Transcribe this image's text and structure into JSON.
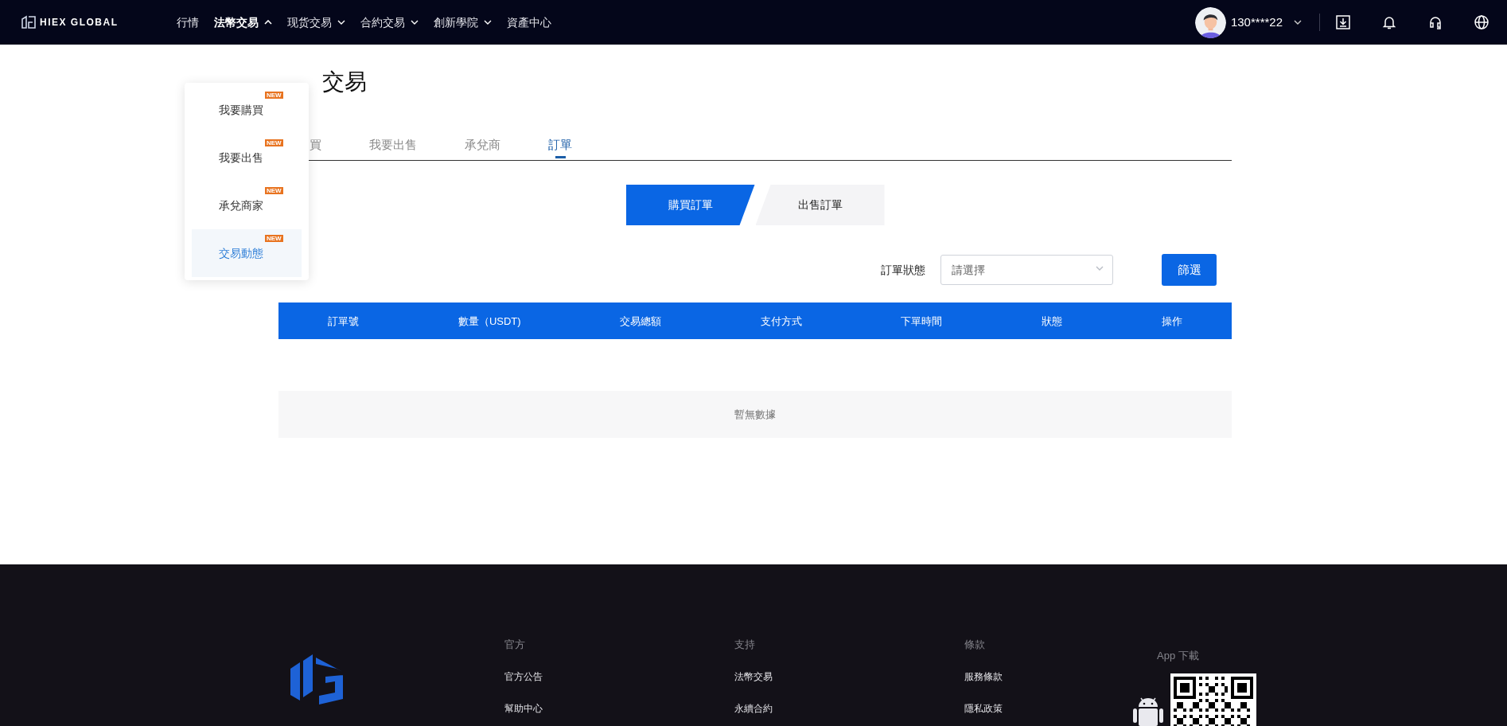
{
  "nav": {
    "brand": "HIEX GLOBAL",
    "items": [
      {
        "label": "行情",
        "kind": "link",
        "selected": false
      },
      {
        "label": "法幣交易",
        "kind": "menu",
        "selected": true,
        "expanded": true
      },
      {
        "label": "现货交易",
        "kind": "menu",
        "selected": false,
        "expanded": false
      },
      {
        "label": "合約交易",
        "kind": "menu",
        "selected": false,
        "expanded": false
      },
      {
        "label": "創新學院",
        "kind": "menu",
        "selected": false,
        "expanded": false
      },
      {
        "label": "資產中心",
        "kind": "link",
        "selected": false
      }
    ]
  },
  "user": {
    "name": "130****22"
  },
  "dropdown": {
    "items": [
      {
        "label": "我要購買",
        "badge": "NEW",
        "selected": false
      },
      {
        "label": "我要出售",
        "badge": "NEW",
        "selected": false
      },
      {
        "label": "承兌商家",
        "badge": "NEW",
        "selected": false
      },
      {
        "label": "交易動態",
        "badge": "NEW",
        "selected": true
      }
    ]
  },
  "page": {
    "title": "交易",
    "tabs": [
      {
        "label": "買",
        "selected": false
      },
      {
        "label": "我要出售",
        "selected": false
      },
      {
        "label": "承兌商",
        "selected": false
      },
      {
        "label": "訂單",
        "selected": true
      }
    ]
  },
  "order_type": [
    {
      "label": "購買訂單",
      "selected": true
    },
    {
      "label": "出售訂單",
      "selected": false
    }
  ],
  "filter": {
    "label": "訂單狀態",
    "placeholder": "請選擇",
    "button": "篩選"
  },
  "table": {
    "columns": [
      "訂單號",
      "數量（USDT)",
      "交易總額",
      "支付方式",
      "下單時間",
      "狀態",
      "操作"
    ],
    "empty_text": "暫無數據"
  },
  "footer": {
    "columns": [
      {
        "heading": "官方",
        "links": [
          "官方公告",
          "幫助中心"
        ]
      },
      {
        "heading": "支持",
        "links": [
          "法幣交易",
          "永續合約"
        ]
      },
      {
        "heading": "條款",
        "links": [
          "服務條款",
          "隱私政策"
        ]
      }
    ],
    "app_heading": "App 下載"
  }
}
